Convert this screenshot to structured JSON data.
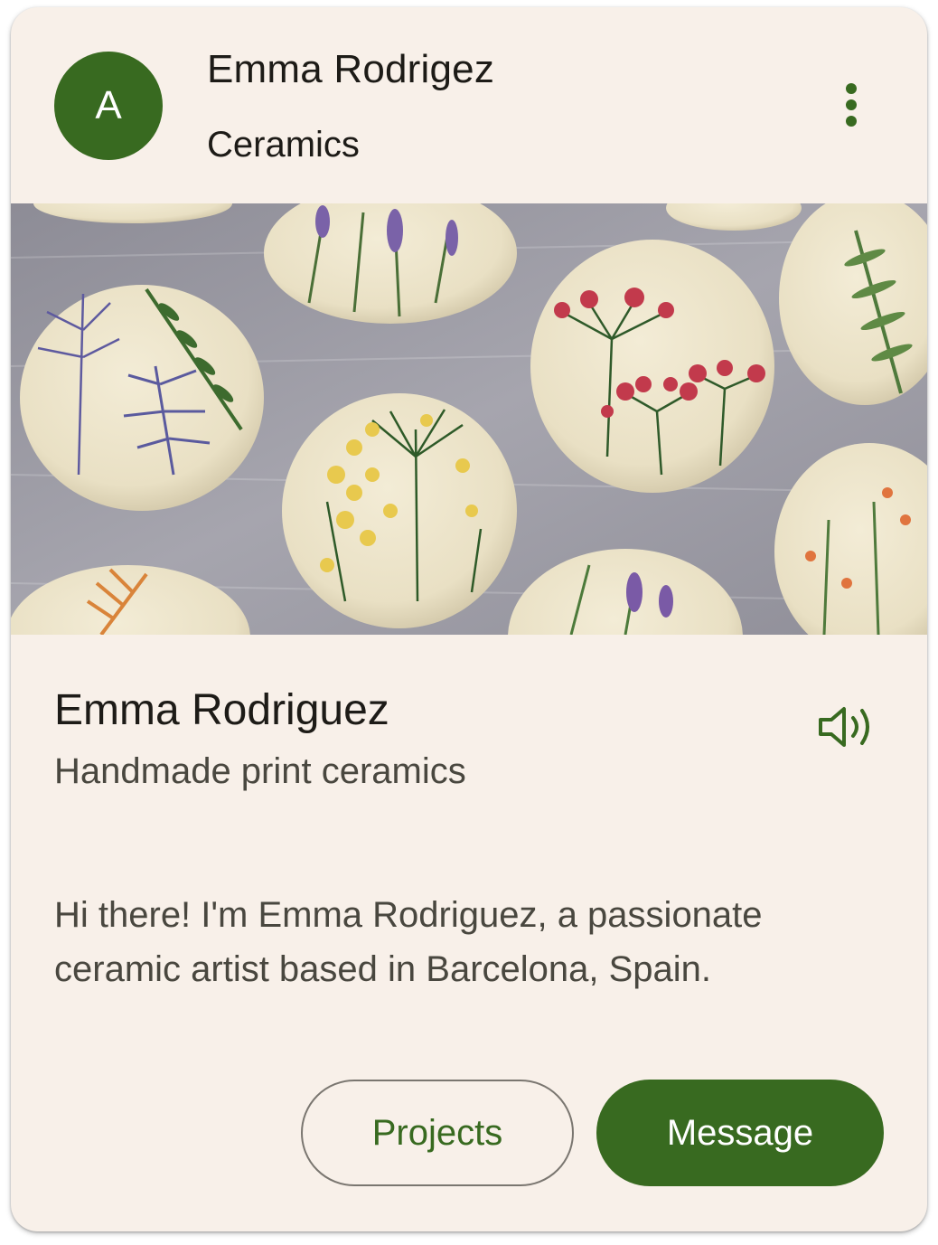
{
  "card": {
    "header": {
      "avatar_letter": "A",
      "title": "Emma Rodrigez",
      "subtitle": "Ceramics",
      "more_icon": "more-vertical-icon"
    },
    "media": {
      "image": "ceramic-plates-with-pressed-flower-prints"
    },
    "body": {
      "title": "Emma Rodriguez",
      "subtitle": "Handmade print ceramics",
      "speaker_icon": "volume-icon",
      "description": "Hi there! I'm Emma Rodriguez, a passionate ceramic artist based in Barcelona, Spain."
    },
    "actions": {
      "secondary_label": "Projects",
      "primary_label": "Message"
    }
  },
  "colors": {
    "primary": "#386a20",
    "surface": "#f8f0e9",
    "on_surface": "#1d1b17",
    "on_surface_variant": "#49473f",
    "outline": "#7a7670"
  }
}
